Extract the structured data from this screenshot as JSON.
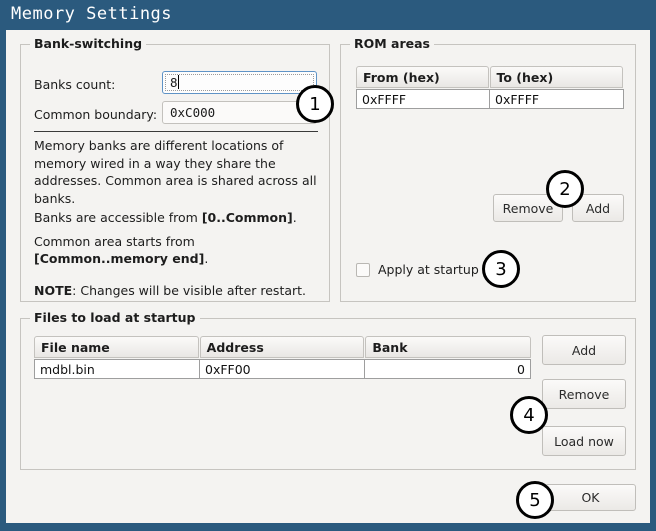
{
  "window": {
    "title": "Memory Settings",
    "titlebar_color": "#2b5a7e",
    "background_color": "#f4f3f1"
  },
  "bank_switching": {
    "legend": "Bank-switching",
    "banks_count_label": "Banks count:",
    "banks_count_value": "8",
    "common_boundary_label": "Common boundary:",
    "common_boundary_value": "0xC000",
    "description_line1": "Memory banks are different locations of",
    "description_line2": "memory wired in a way they share the",
    "description_line3": "addresses. Common area is shared across all",
    "description_line4": "banks.",
    "accessible_prefix": "Banks are accessible from ",
    "accessible_bold": "[0..Common]",
    "accessible_suffix": ".",
    "common_prefix": "Common area starts from ",
    "common_bold": "[Common..memory end]",
    "common_suffix": ".",
    "note_bold": "NOTE",
    "note_text": ": Changes will be visible after restart."
  },
  "rom_areas": {
    "legend": "ROM areas",
    "columns": [
      "From (hex)",
      "To (hex)"
    ],
    "rows": [
      [
        "0xFFFF",
        "0xFFFF"
      ]
    ],
    "remove_label": "Remove",
    "add_label": "Add",
    "apply_at_startup_label": "Apply at startup",
    "apply_at_startup_checked": false
  },
  "files_to_load": {
    "legend": "Files to load at startup",
    "columns": [
      "File name",
      "Address",
      "Bank"
    ],
    "rows": [
      {
        "file_name": "mdbl.bin",
        "address": "0xFF00",
        "bank": "0"
      }
    ],
    "add_label": "Add",
    "remove_label": "Remove",
    "load_now_label": "Load now"
  },
  "footer": {
    "ok_label": "OK"
  },
  "annotations": {
    "badges": [
      {
        "id": "1",
        "label": "1"
      },
      {
        "id": "2",
        "label": "2"
      },
      {
        "id": "3",
        "label": "3"
      },
      {
        "id": "4",
        "label": "4"
      },
      {
        "id": "5",
        "label": "5"
      }
    ]
  }
}
